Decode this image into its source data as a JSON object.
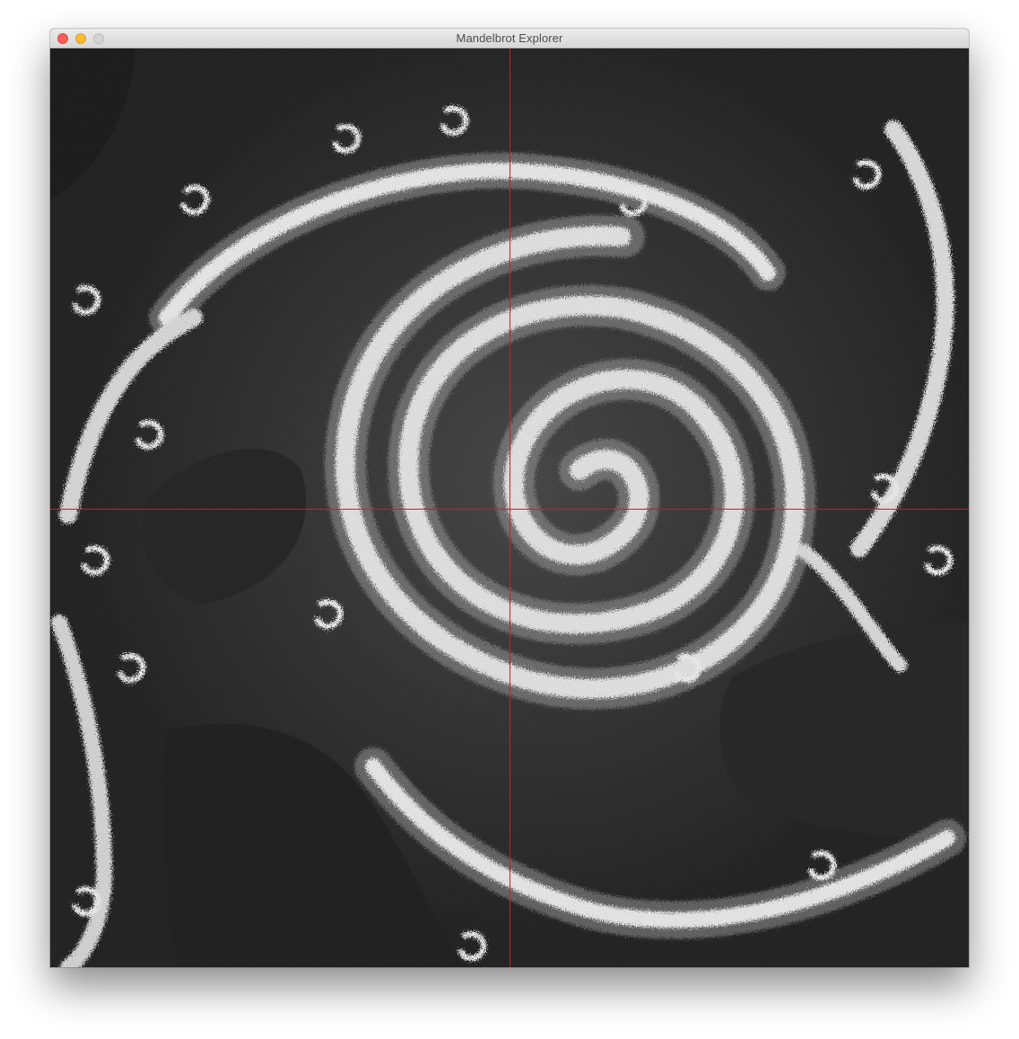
{
  "window": {
    "title": "Mandelbrot Explorer"
  },
  "colors": {
    "crosshair": "#e0161b",
    "background": "#262626",
    "fractal": "#e8e8e8"
  },
  "icons": {
    "close": "close-icon",
    "minimize": "minimize-icon",
    "zoom": "zoom-icon"
  }
}
